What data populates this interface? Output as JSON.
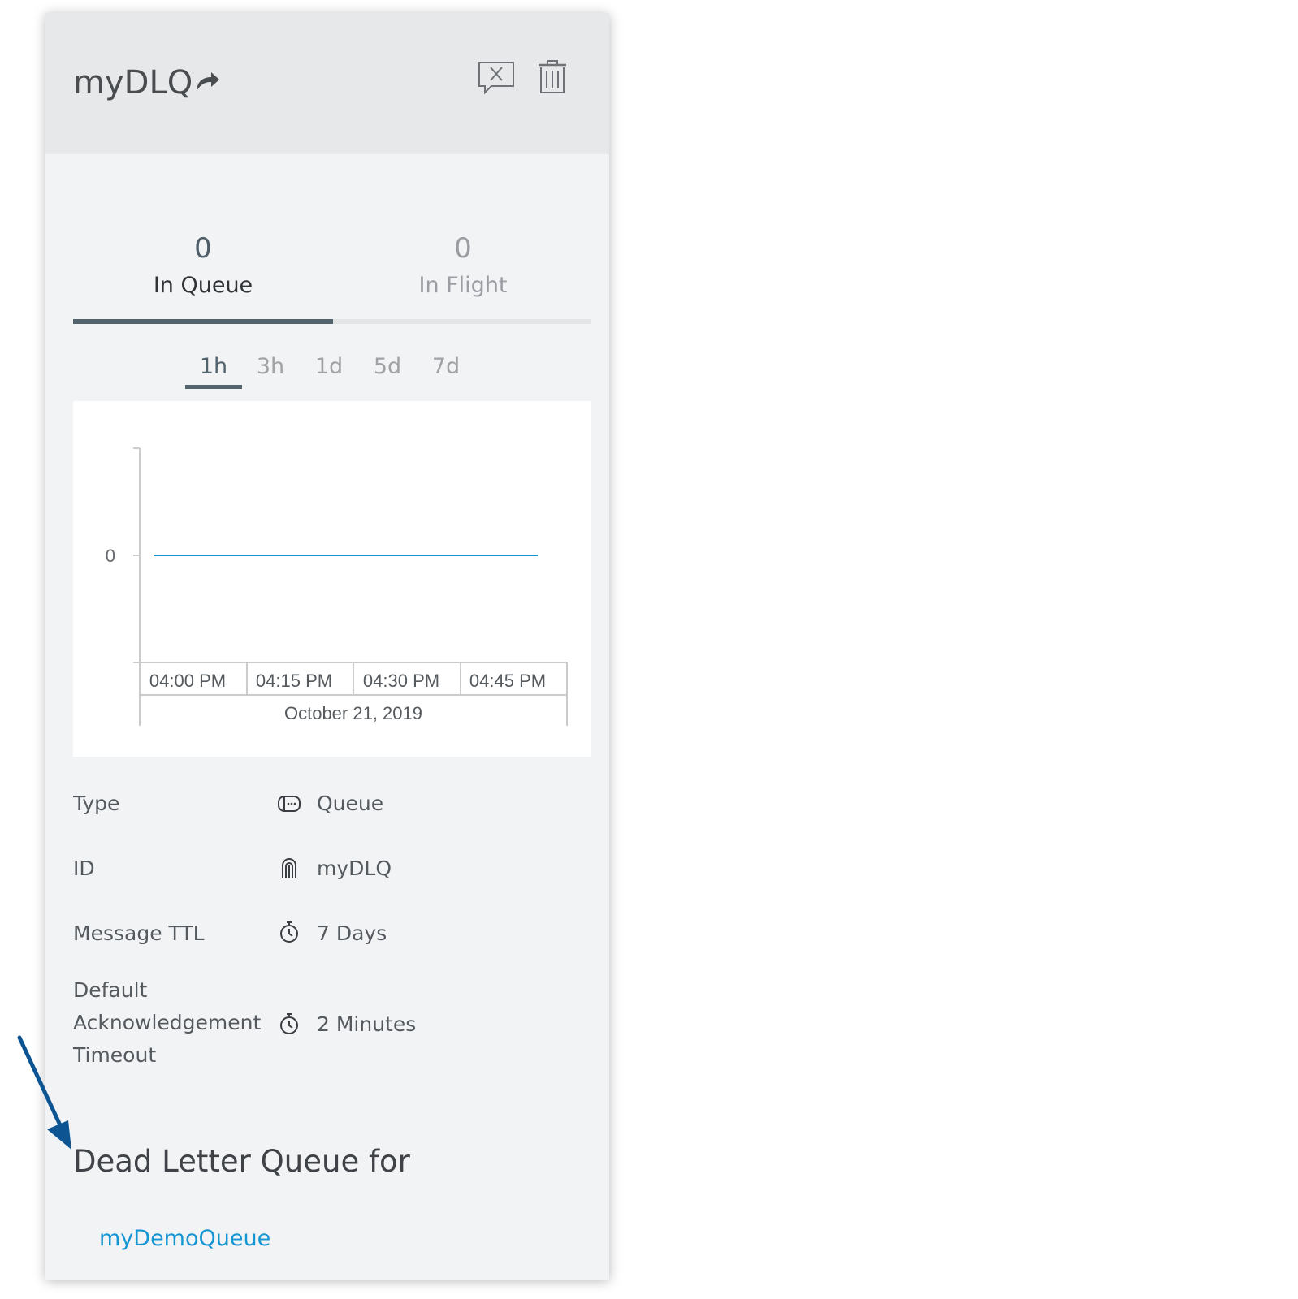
{
  "header": {
    "title": "myDLQ",
    "title_icon": "share-arrow-icon",
    "actions": [
      {
        "name": "purge-messages-button",
        "icon": "message-clear-icon"
      },
      {
        "name": "delete-queue-button",
        "icon": "trash-icon"
      }
    ]
  },
  "stats": [
    {
      "value": "0",
      "label": "In Queue",
      "active": true
    },
    {
      "value": "0",
      "label": "In Flight",
      "active": false
    }
  ],
  "time_ranges": {
    "options": [
      "1h",
      "3h",
      "1d",
      "5d",
      "7d"
    ],
    "selected": "1h"
  },
  "chart_data": {
    "type": "line",
    "x": [
      "04:00 PM",
      "04:15 PM",
      "04:30 PM",
      "04:45 PM"
    ],
    "x_group_label": "October 21, 2019",
    "y_ticks": [
      "0"
    ],
    "series": [
      {
        "values": [
          0,
          0,
          0,
          0
        ],
        "color": "#1596d3"
      }
    ],
    "legend": "none",
    "grid": false
  },
  "properties": [
    {
      "label": "Type",
      "icon": "queue-icon",
      "value": "Queue"
    },
    {
      "label": "ID",
      "icon": "fingerprint-icon",
      "value": "myDLQ"
    },
    {
      "label": "Message TTL",
      "icon": "stopwatch-icon",
      "value": "7 Days"
    },
    {
      "label_lines": [
        "Default",
        "Acknowledgement",
        "Timeout"
      ],
      "icon": "stopwatch-icon",
      "value": "2 Minutes"
    }
  ],
  "dead_letter": {
    "heading": "Dead Letter Queue for",
    "source_queue": "myDemoQueue"
  },
  "colors": {
    "accent": "#52636d",
    "link": "#1596d3",
    "annotation": "#0d5592",
    "panel_bg": "#f2f3f5",
    "header_bg": "#e7e8ea"
  }
}
